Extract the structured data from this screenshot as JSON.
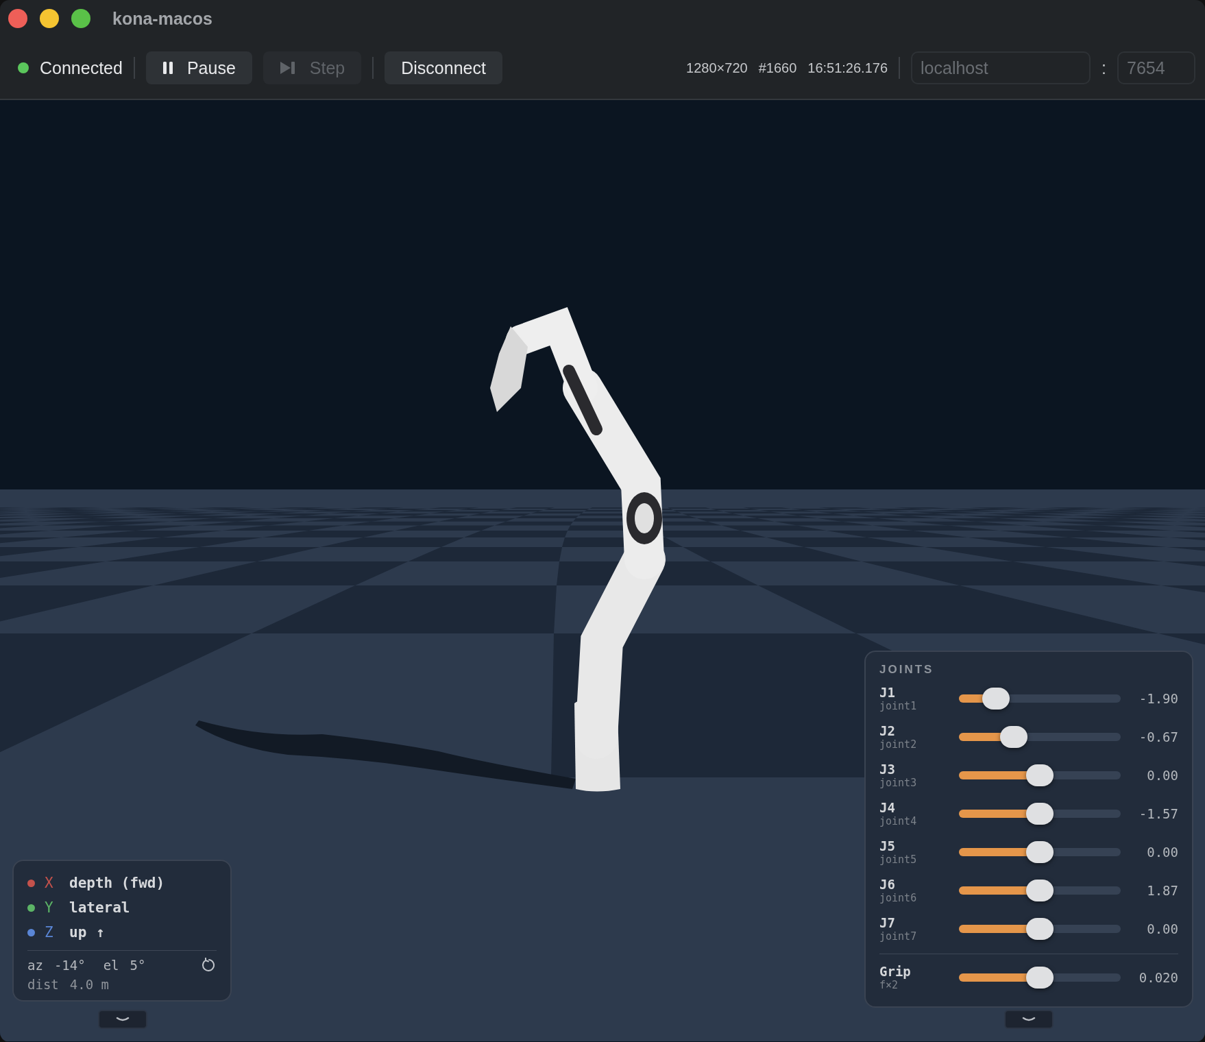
{
  "window": {
    "title": "kona-macos"
  },
  "toolbar": {
    "status": {
      "label": "Connected",
      "connected": true
    },
    "buttons": [
      {
        "kind": "pause",
        "label": "Pause",
        "disabled": false
      },
      {
        "kind": "step",
        "label": "Step",
        "disabled": true
      },
      {
        "kind": "text",
        "label": "Disconnect",
        "disabled": false
      }
    ],
    "stats": [
      "1280×720",
      "#1660",
      "16:51:26.176"
    ],
    "host": {
      "placeholder": "localhost"
    },
    "separator": ":",
    "port": {
      "placeholder": "7654"
    }
  },
  "axes_legend": {
    "axes": [
      {
        "axis": "X",
        "label": "depth (fwd)",
        "color": "#c4524c"
      },
      {
        "axis": "Y",
        "label": "lateral",
        "color": "#5cb466"
      },
      {
        "axis": "Z",
        "label": "up",
        "color": "#5a86d6",
        "indicator": "↑"
      }
    ],
    "camera": [
      {
        "label": "az",
        "value": "-14°"
      },
      {
        "label": "el",
        "value": "5°"
      },
      {
        "label": "dist",
        "value": "4.0 m"
      }
    ]
  },
  "joints_panel": {
    "title": "JOINTS",
    "joints": [
      {
        "name": "J1",
        "id": "joint1",
        "level": 0.23,
        "reading": "-1.90"
      },
      {
        "name": "J2",
        "id": "joint2",
        "level": 0.34,
        "reading": "-0.67"
      },
      {
        "name": "J3",
        "id": "joint3",
        "level": 0.5,
        "reading": "0.00"
      },
      {
        "name": "J4",
        "id": "joint4",
        "level": 0.5,
        "reading": "-1.57"
      },
      {
        "name": "J5",
        "id": "joint5",
        "level": 0.5,
        "reading": "0.00"
      },
      {
        "name": "J6",
        "id": "joint6",
        "level": 0.5,
        "reading": "1.87"
      },
      {
        "name": "J7",
        "id": "joint7",
        "level": 0.5,
        "reading": "0.00"
      }
    ],
    "grip": {
      "name": "Grip",
      "id": "f×2",
      "level": 0.5,
      "reading": "0.020"
    }
  }
}
